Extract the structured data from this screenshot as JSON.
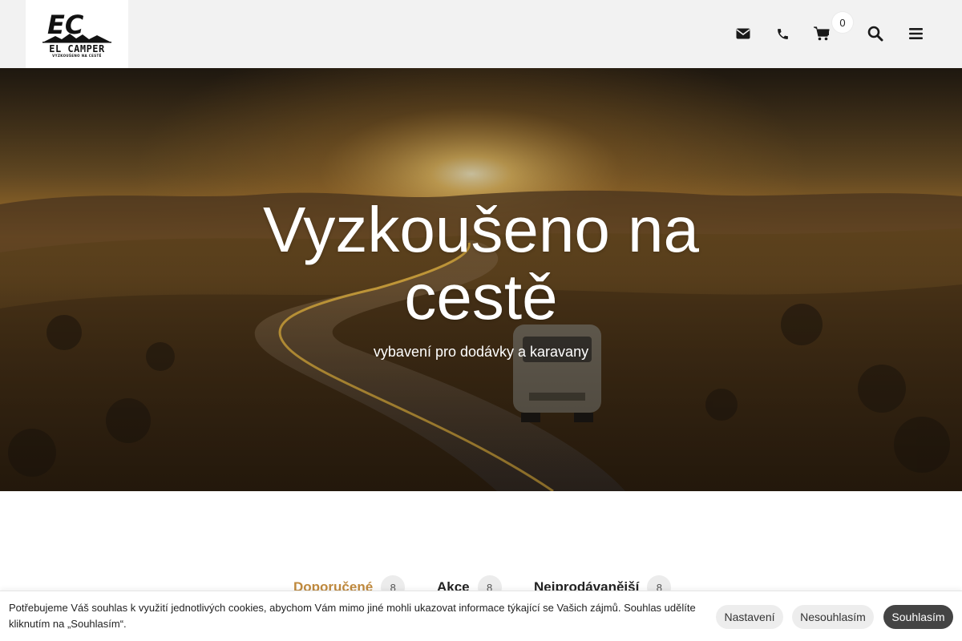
{
  "header": {
    "logo": {
      "brand": "EL CAMPER",
      "tagline": "VYZKOUŠENO NA CESTĚ",
      "monogram": "EC"
    },
    "icons": [
      "envelope-icon",
      "phone-icon",
      "cart-icon",
      "search-icon",
      "menu-icon"
    ],
    "cart_count": "0"
  },
  "hero": {
    "title": "Vyzkoušeno na cestě",
    "subtitle": "vybavení pro dodávky a karavany"
  },
  "tabs": [
    {
      "label": "Doporučené",
      "count": "8",
      "active": true
    },
    {
      "label": "Akce",
      "count": "8",
      "active": false
    },
    {
      "label": "Nejprodávanější",
      "count": "8",
      "active": false
    }
  ],
  "cookie_bar": {
    "text": "Potřebujeme Váš souhlas k využití jednotlivých cookies, abychom Vám mimo jiné mohli ukazovat informace týkající se Vašich zájmů. Souhlas udělíte kliknutím na „Souhlasím“.",
    "settings_label": "Nastavení",
    "reject_label": "Nesouhlasím",
    "accept_label": "Souhlasím"
  },
  "colors": {
    "accent": "#c08a3e",
    "header_bg": "#f2f2f2",
    "accept_button_bg": "#444444"
  }
}
